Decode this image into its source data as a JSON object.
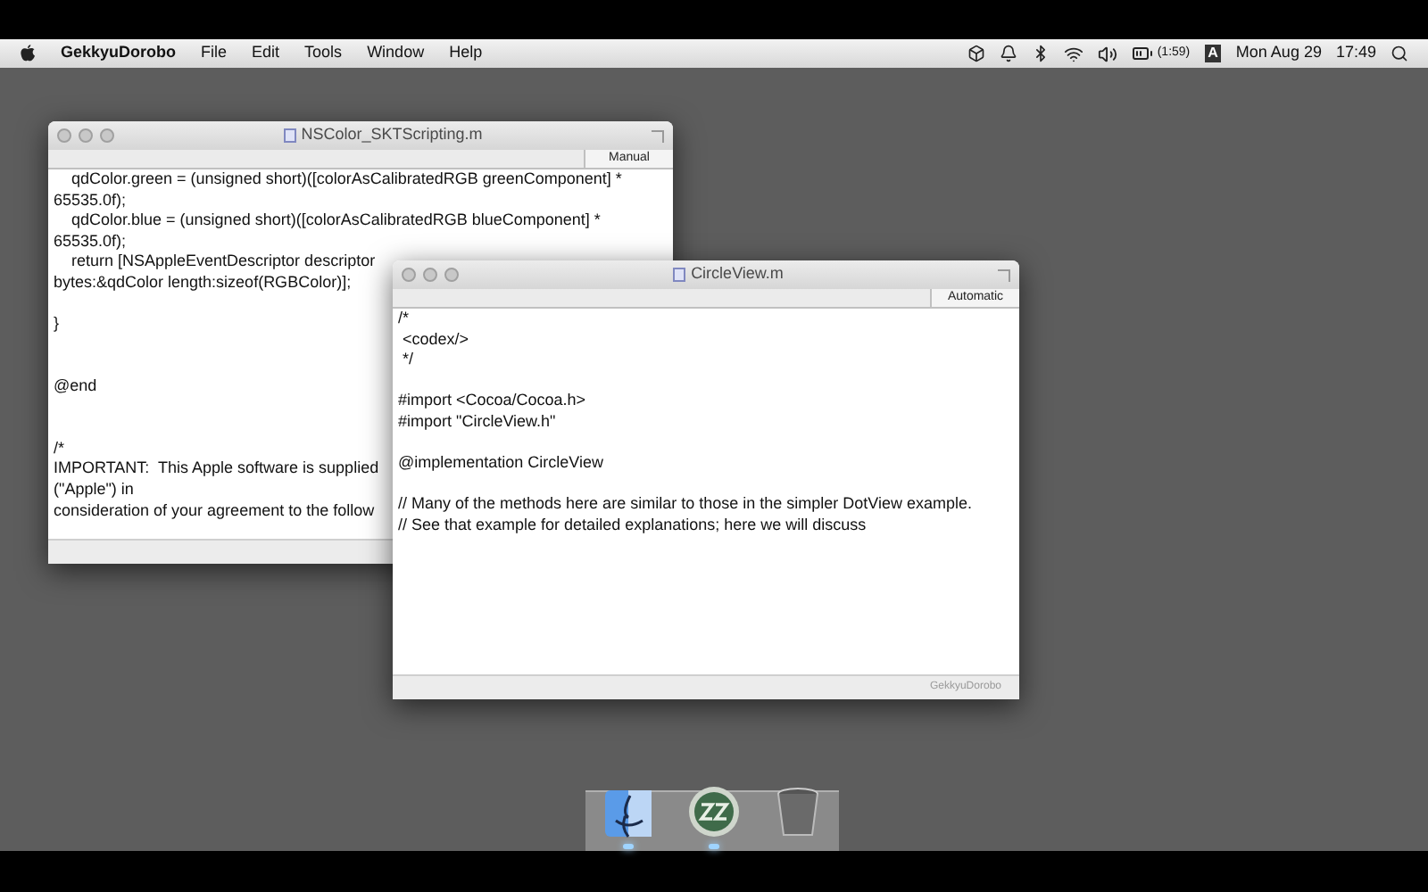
{
  "menu_bar": {
    "app_name": "GekkyuDorobo",
    "items": [
      "File",
      "Edit",
      "Tools",
      "Window",
      "Help"
    ],
    "battery_time": "(1:59)",
    "input_source": "A",
    "date": "Mon Aug 29",
    "time": "17:49"
  },
  "windows": [
    {
      "title": "NSColor_SKTScripting.m",
      "mode_button": "Manual",
      "lines": [
        {
          "kind": "code",
          "text": "    qdColor.green = (unsigned short)([colorAsCalibratedRGB greenComponent] *"
        },
        {
          "kind": "code",
          "text": "65535.0f);"
        },
        {
          "kind": "code",
          "text": "    qdColor.blue = (unsigned short)([colorAsCalibratedRGB blueComponent] *"
        },
        {
          "kind": "code",
          "text": "65535.0f);"
        },
        {
          "kind": "code",
          "text": "    return [NSAppleEventDescriptor descriptor"
        },
        {
          "kind": "code",
          "text": "bytes:&qdColor length:sizeof(RGBColor)];"
        },
        {
          "kind": "blank"
        },
        {
          "kind": "code",
          "text": "}"
        },
        {
          "kind": "blank"
        },
        {
          "kind": "blank"
        },
        {
          "kind": "code",
          "text": "@end"
        },
        {
          "kind": "blank"
        },
        {
          "kind": "blank"
        },
        {
          "kind": "code",
          "text": "/*"
        },
        {
          "kind": "code",
          "text": "IMPORTANT:  This Apple software is supplied"
        },
        {
          "kind": "code",
          "text": "(\"Apple\") in"
        },
        {
          "kind": "code",
          "text": "consideration of your agreement to the follow"
        }
      ]
    },
    {
      "title": "CircleView.m",
      "mode_button": "Automatic",
      "footer": "GekkyuDorobo",
      "lines": [
        {
          "kind": "code",
          "text": "/*"
        },
        {
          "kind": "code",
          "text": " <codex/>"
        },
        {
          "kind": "code",
          "text": " */"
        },
        {
          "kind": "blank"
        },
        {
          "kind": "code",
          "text": "#import <Cocoa/Cocoa.h>"
        },
        {
          "kind": "code",
          "text": "#import \"CircleView.h\""
        },
        {
          "kind": "blank"
        },
        {
          "kind": "code",
          "text": "@implementation CircleView"
        },
        {
          "kind": "blank"
        },
        {
          "kind": "code",
          "text": "// Many of the methods here are similar to those in the simpler DotView example."
        },
        {
          "kind": "code",
          "text": "// See that example for detailed explanations; here we will discuss"
        }
      ]
    }
  ],
  "dock": [
    {
      "kind": "finder",
      "running": true
    },
    {
      "kind": "sleep",
      "running": true
    },
    {
      "kind": "trash",
      "running": false
    }
  ]
}
